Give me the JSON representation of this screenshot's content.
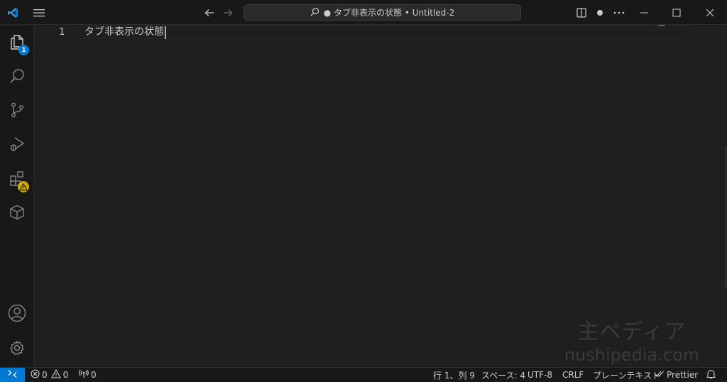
{
  "titlebar": {
    "command_center_text": "● タブ非表示の状態 • Untitled-2"
  },
  "activitybar": {
    "items": [
      {
        "name": "explorer",
        "badge": "1"
      },
      {
        "name": "search"
      },
      {
        "name": "source-control"
      },
      {
        "name": "run-and-debug"
      },
      {
        "name": "extensions",
        "badge": "warning"
      },
      {
        "name": "remote-explorer"
      }
    ],
    "bottom": [
      "accounts",
      "manage"
    ]
  },
  "editor": {
    "line_number": "1",
    "line_text": "タブ非表示の状態"
  },
  "watermark": {
    "title": "主ペディア",
    "subtitle": "nushipedia.com"
  },
  "statusbar": {
    "errors": "0",
    "warnings": "0",
    "ports": "0",
    "position": "行 1、列 9",
    "indent": "スペース: 4",
    "encoding": "UTF-8",
    "eol": "CRLF",
    "language": "プレーンテキスト",
    "formatter": "Prettier"
  },
  "colors": {
    "accent": "#0078d4",
    "warning": "#cca700",
    "background": "#1f1f1f",
    "chrome": "#181818"
  }
}
